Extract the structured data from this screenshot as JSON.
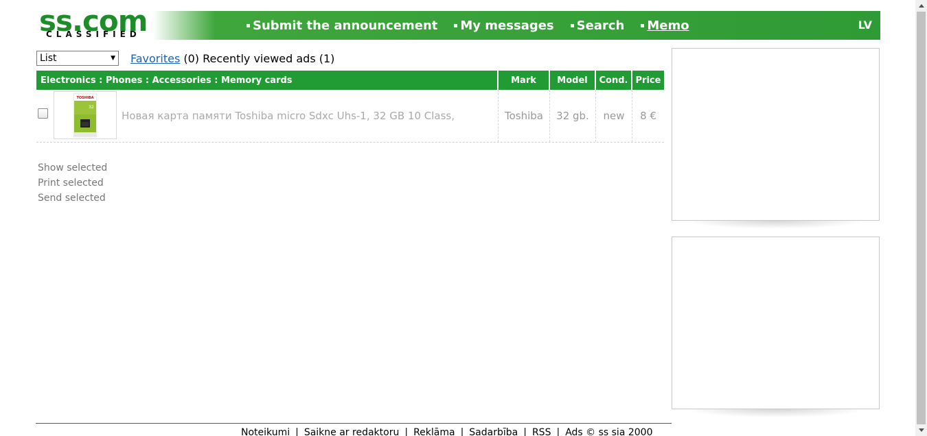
{
  "header": {
    "logo_main": "ss.com",
    "logo_sub": "CLASSIFIED",
    "nav": [
      {
        "label": "Submit the announcement"
      },
      {
        "label": "My messages"
      },
      {
        "label": "Search"
      },
      {
        "label": "Memo"
      }
    ],
    "lang": "LV"
  },
  "toolbar": {
    "view_select": "List",
    "favorites_link": "Favorites",
    "favorites_count": "(0)",
    "recent_text": "Recently viewed ads (1)"
  },
  "table": {
    "headers": {
      "category": "Electronics : Phones : Accessories : Memory cards",
      "mark": "Mark",
      "model": "Model",
      "cond": "Cond.",
      "price": "Price"
    },
    "rows": [
      {
        "title": "Новая карта памяти Toshiba micro Sdxc Uhs-1, 32 GB 10 Class,",
        "mark": "Toshiba",
        "model": "32 gb.",
        "cond": "new",
        "price": "8 €",
        "thumb_brand": "TOSHIBA",
        "thumb_capacity": "32"
      }
    ]
  },
  "actions": {
    "show": "Show selected",
    "print": "Print selected",
    "send": "Send selected"
  },
  "footer": {
    "links": [
      "Noteikumi",
      "Saikne ar redaktoru",
      "Reklāma",
      "Sadarbība",
      "RSS"
    ],
    "copyright": "Ads © ss sia 2000"
  },
  "colors": {
    "brand_green": "#219c35",
    "logo_green": "#1d8d2a",
    "link_blue": "#1a63b5"
  }
}
